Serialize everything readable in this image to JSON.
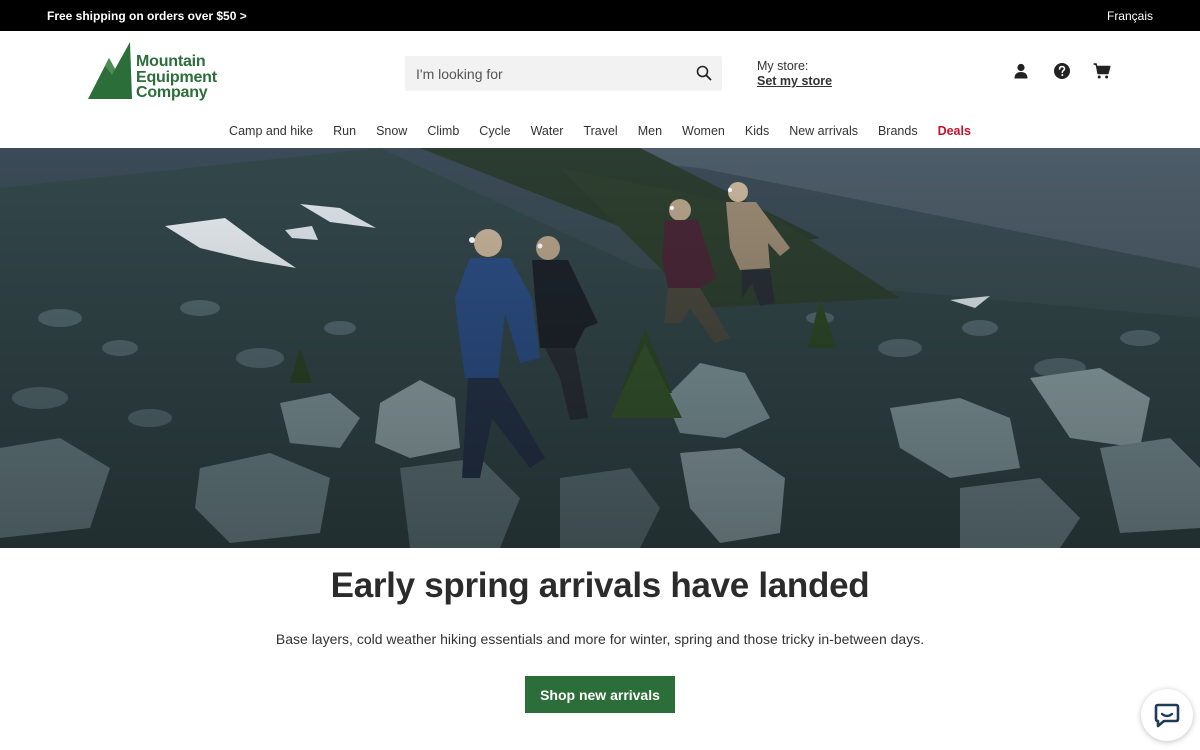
{
  "topbar": {
    "promo": "Free shipping on orders over $50 >",
    "language": "Français"
  },
  "brand": {
    "name_line1": "Mountain",
    "name_line2": "Equipment",
    "name_line3": "Company",
    "color": "#2c6e3a"
  },
  "search": {
    "placeholder": "I'm looking for",
    "icon": "search-icon"
  },
  "store": {
    "label": "My store:",
    "link": "Set my store"
  },
  "header_icons": [
    "account-icon",
    "help-icon",
    "cart-icon"
  ],
  "nav": {
    "items": [
      "Camp and hike",
      "Run",
      "Snow",
      "Climb",
      "Cycle",
      "Water",
      "Travel",
      "Men",
      "Women",
      "Kids",
      "New arrivals",
      "Brands"
    ],
    "deals": "Deals",
    "deals_color": "#c8102e"
  },
  "hero": {
    "headline": "Early spring arrivals have landed",
    "subline": "Base layers, cold weather hiking essentials and more for winter, spring and those tricky in-between days.",
    "cta": "Shop new arrivals"
  },
  "chat": {
    "icon": "chat-icon"
  }
}
